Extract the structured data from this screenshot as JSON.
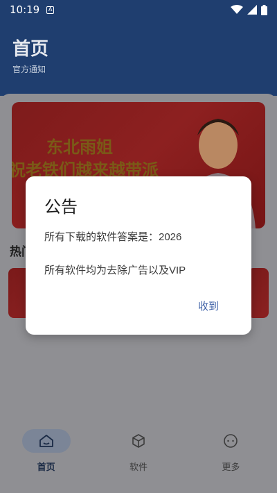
{
  "status_bar": {
    "time": "10:19",
    "icons": [
      "app-a-icon",
      "wifi-icon",
      "signal-icon",
      "battery-icon"
    ]
  },
  "header": {
    "title": "首页",
    "subtitle": "官方通知"
  },
  "banner": {
    "line1": "东北雨姐",
    "line2": "祝老铁们越来越带派"
  },
  "section": {
    "title": "热门"
  },
  "dialog": {
    "title": "公告",
    "message_line1": "所有下载的软件答案是：2026",
    "message_line2": "所有软件均为去除广告以及VIP",
    "ok_label": "收到"
  },
  "bottom_nav": {
    "items": [
      {
        "label": "首页",
        "icon": "home-icon",
        "active": true
      },
      {
        "label": "软件",
        "icon": "cube-icon",
        "active": false
      },
      {
        "label": "更多",
        "icon": "more-icon",
        "active": false
      }
    ]
  },
  "colors": {
    "header_bg": "#1f3e6f",
    "scrim": "#8f8f93",
    "accent": "#3c5fa6",
    "banner_red": "#8d2020"
  }
}
